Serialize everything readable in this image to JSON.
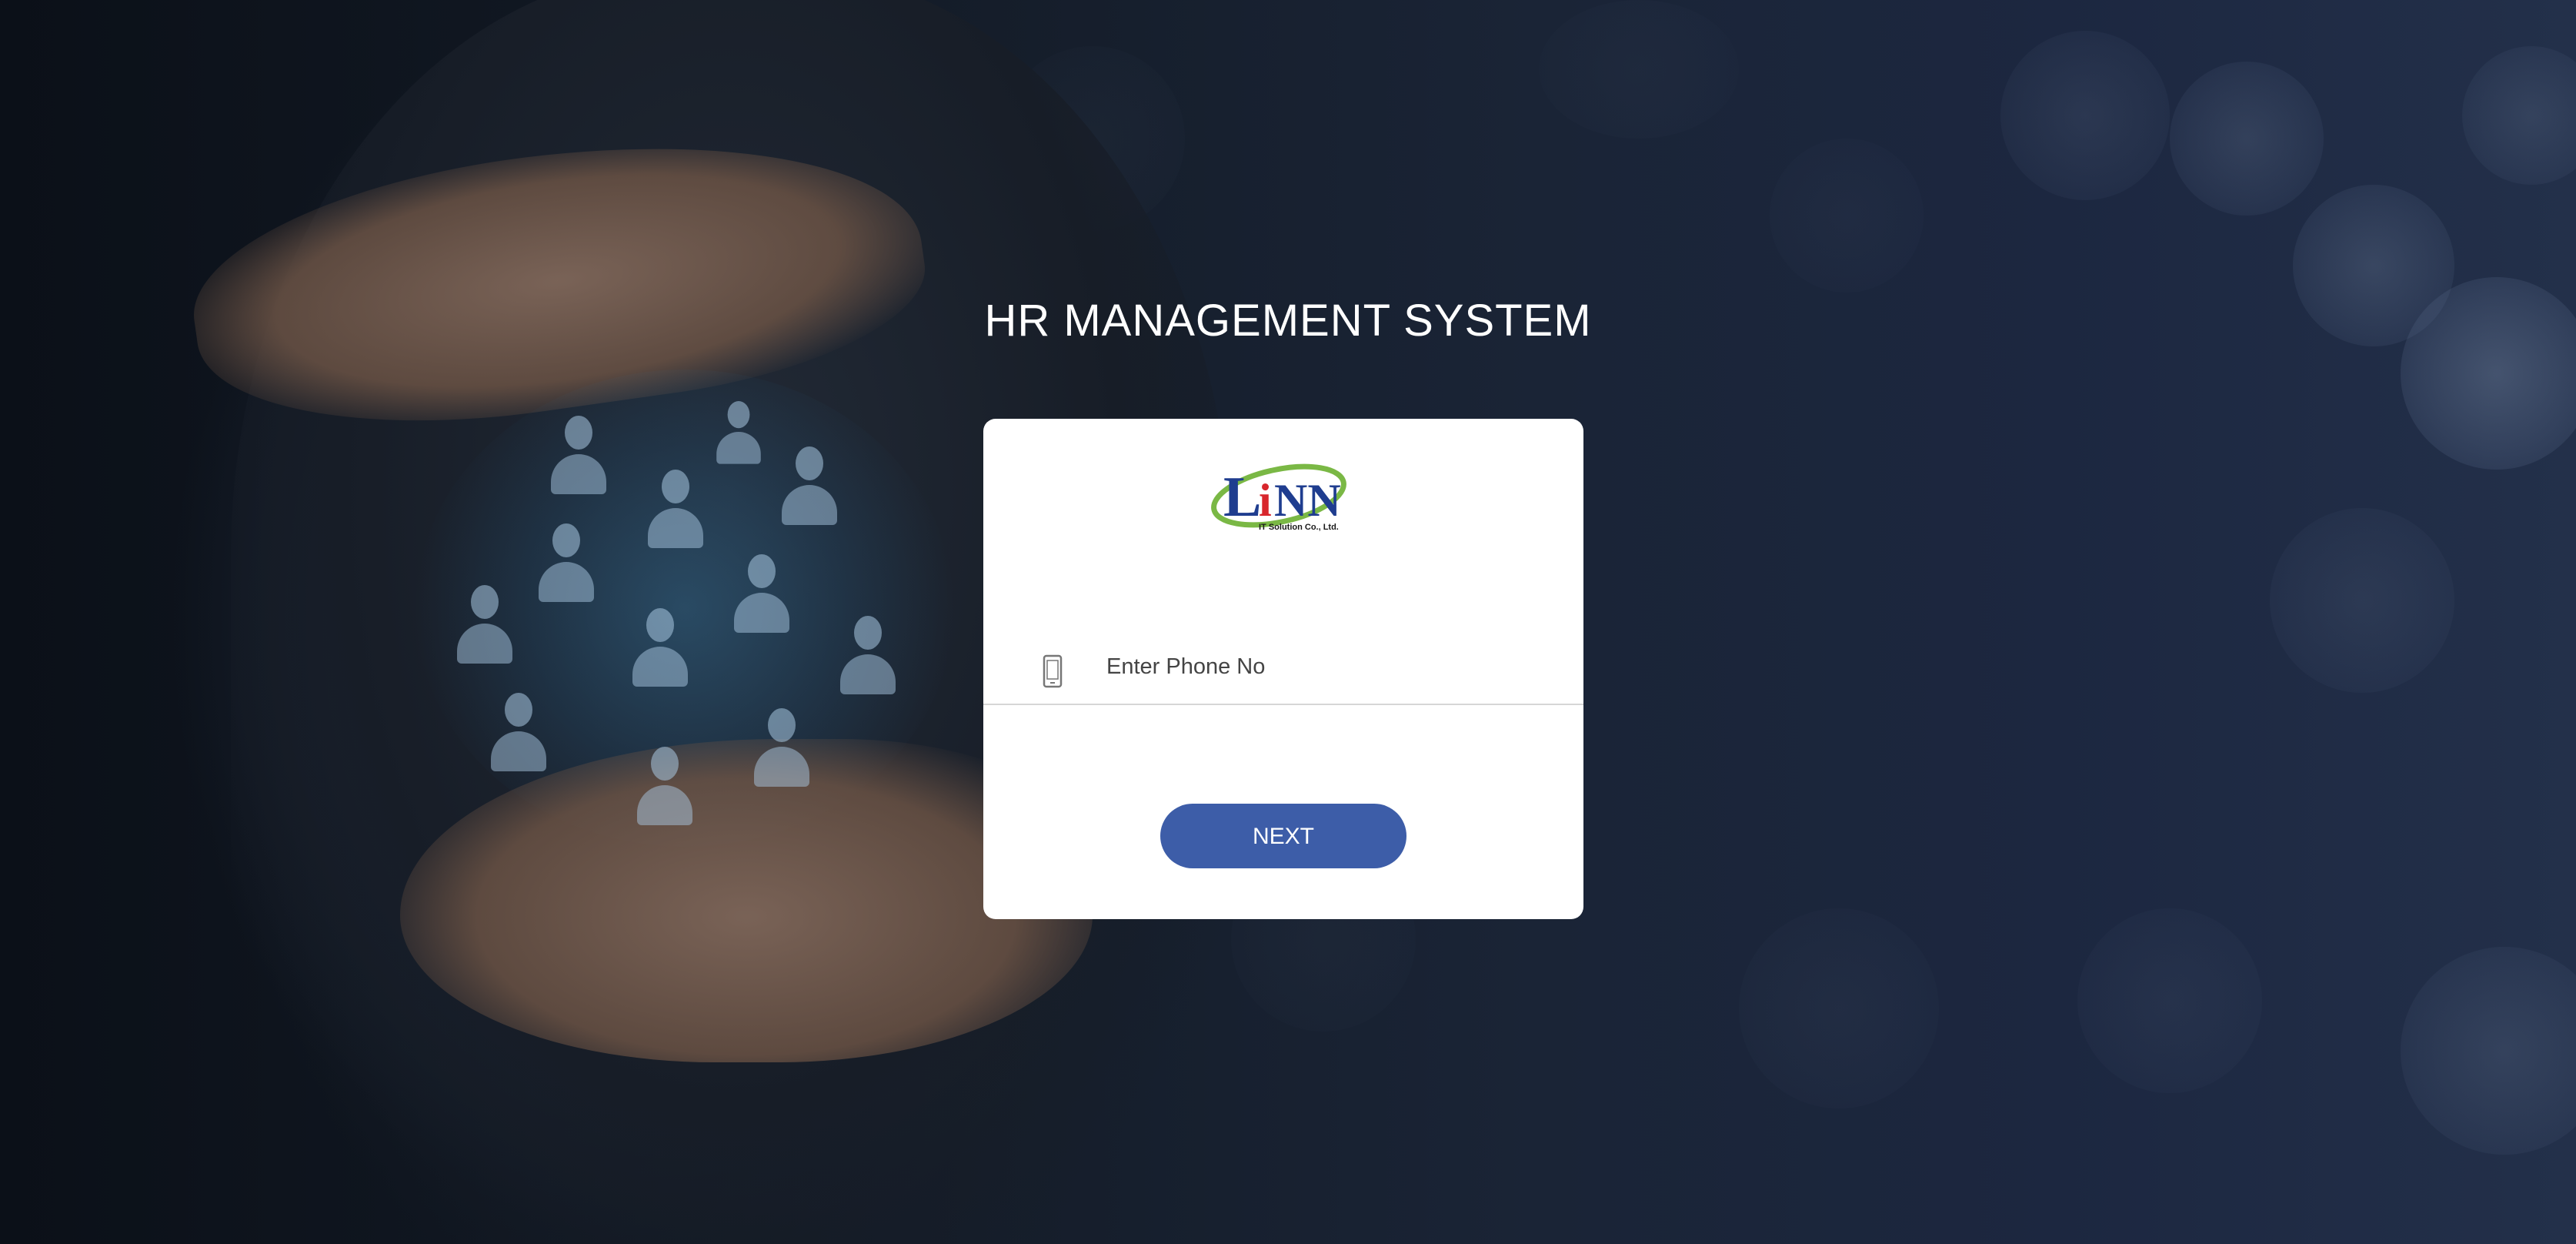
{
  "page": {
    "title": "HR MANAGEMENT SYSTEM"
  },
  "login_card": {
    "logo": {
      "brand": "LINN",
      "tagline": "IT Solution Co., Ltd."
    },
    "phone_field": {
      "icon": "mobile-phone-icon",
      "placeholder": "Enter Phone No",
      "value": ""
    },
    "next_button_label": "NEXT"
  },
  "colors": {
    "button": "#3d5da8",
    "card": "#ffffff",
    "title_text": "#ffffff",
    "logo_blue": "#1f3d8f",
    "logo_green": "#7ab845",
    "logo_red": "#d8262c"
  }
}
